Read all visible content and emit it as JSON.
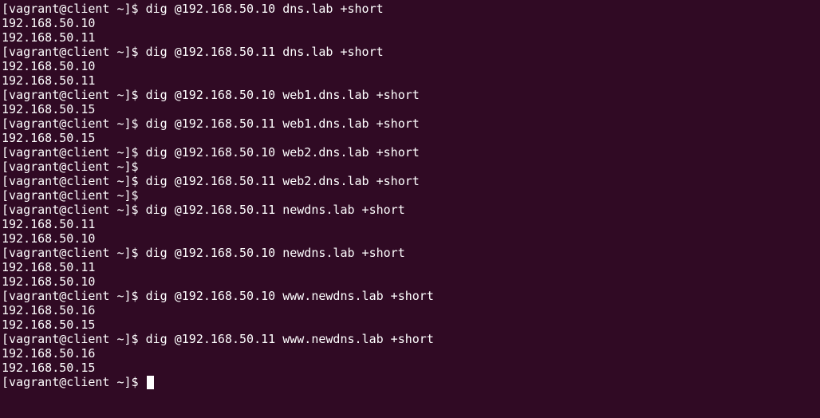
{
  "terminal": {
    "prompt": "[vagrant@client ~]$",
    "lines": [
      "[vagrant@client ~]$ dig @192.168.50.10 dns.lab +short",
      "192.168.50.10",
      "192.168.50.11",
      "[vagrant@client ~]$ dig @192.168.50.11 dns.lab +short",
      "192.168.50.10",
      "192.168.50.11",
      "[vagrant@client ~]$ dig @192.168.50.10 web1.dns.lab +short",
      "192.168.50.15",
      "[vagrant@client ~]$ dig @192.168.50.11 web1.dns.lab +short",
      "192.168.50.15",
      "[vagrant@client ~]$ dig @192.168.50.10 web2.dns.lab +short",
      "[vagrant@client ~]$",
      "[vagrant@client ~]$ dig @192.168.50.11 web2.dns.lab +short",
      "[vagrant@client ~]$",
      "[vagrant@client ~]$ dig @192.168.50.11 newdns.lab +short",
      "192.168.50.11",
      "192.168.50.10",
      "[vagrant@client ~]$ dig @192.168.50.10 newdns.lab +short",
      "192.168.50.11",
      "192.168.50.10",
      "[vagrant@client ~]$ dig @192.168.50.10 www.newdns.lab +short",
      "192.168.50.16",
      "192.168.50.15",
      "[vagrant@client ~]$ dig @192.168.50.11 www.newdns.lab +short",
      "192.168.50.16",
      "192.168.50.15"
    ],
    "colors": {
      "background": "#300a24",
      "foreground": "#ffffff"
    }
  }
}
